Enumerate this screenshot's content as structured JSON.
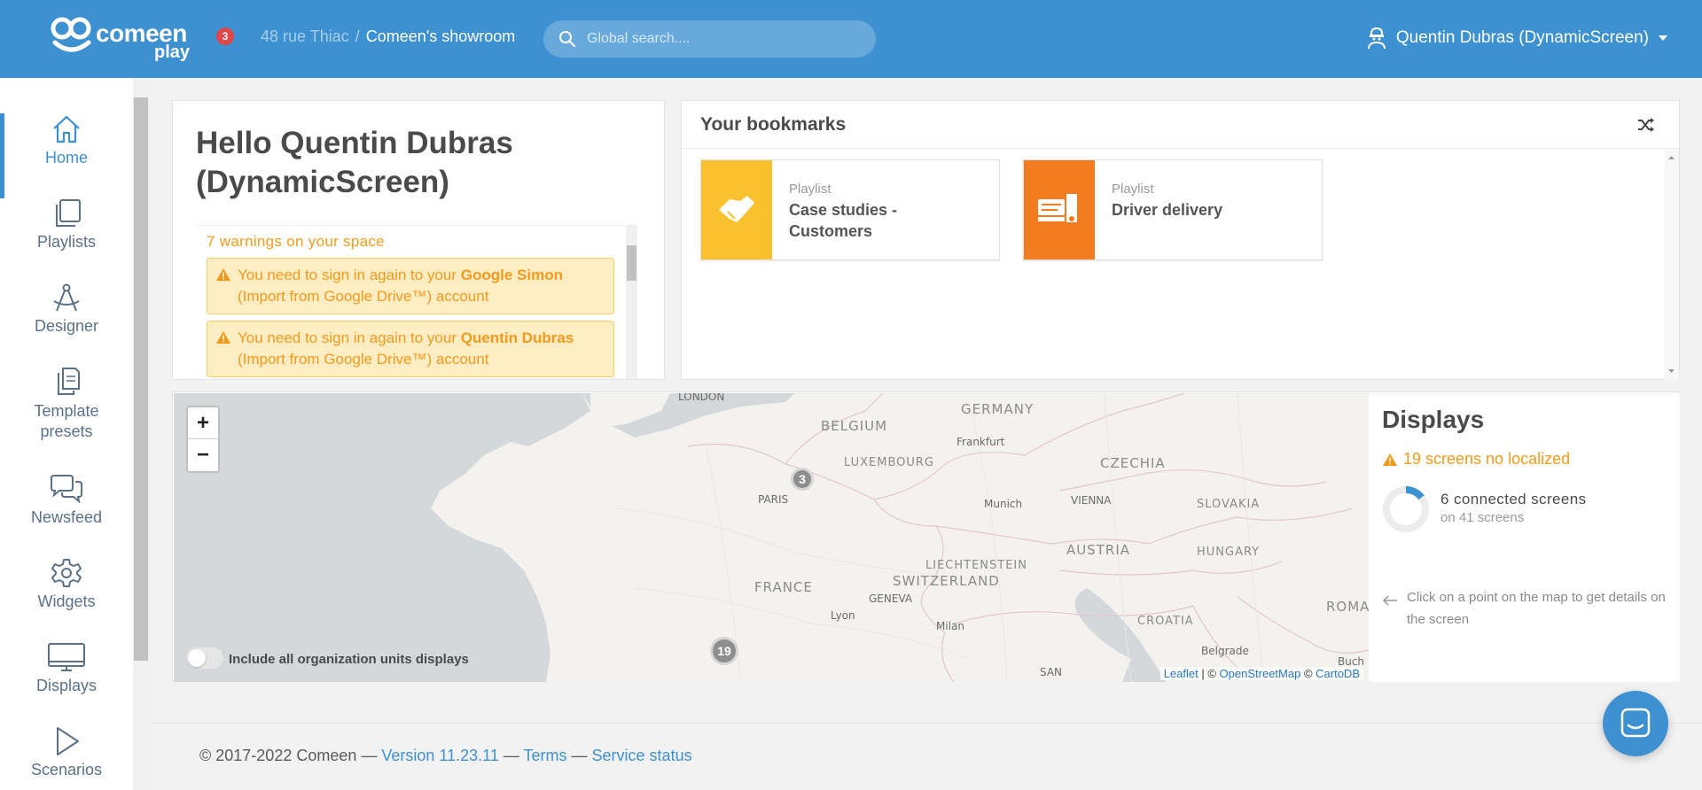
{
  "header": {
    "brand": "comeen",
    "brand_sub": "play",
    "notification_count": "3",
    "breadcrumb": {
      "address": "48 rue Thiac",
      "separator": "/",
      "current": "Comeen's showroom"
    },
    "search_placeholder": "Global search....",
    "user_name": "Quentin Dubras (DynamicScreen)"
  },
  "sidebar": {
    "items": [
      {
        "label": "Home",
        "icon": "home-icon",
        "active": true
      },
      {
        "label": "Playlists",
        "icon": "playlists-icon"
      },
      {
        "label": "Designer",
        "icon": "designer-icon"
      },
      {
        "label": "Template presets",
        "icon": "template-presets-icon"
      },
      {
        "label": "Newsfeed",
        "icon": "newsfeed-icon"
      },
      {
        "label": "Widgets",
        "icon": "widgets-icon"
      },
      {
        "label": "Displays",
        "icon": "displays-icon"
      },
      {
        "label": "Scenarios",
        "icon": "scenarios-icon"
      }
    ]
  },
  "hello": {
    "title": "Hello Quentin Dubras (DynamicScreen)",
    "warnings_title": "7 warnings on your space",
    "warnings": [
      {
        "prefix": "You need to sign in again to your ",
        "account": "Google Simon",
        "suffix": " (Import from Google Drive™) account"
      },
      {
        "prefix": "You need to sign in again to your ",
        "account": "Quentin Dubras",
        "suffix": " (Import from Google Drive™) account"
      }
    ]
  },
  "bookmarks": {
    "title": "Your bookmarks",
    "items": [
      {
        "type": "Playlist",
        "name": "Case studies - Customers",
        "color": "#f9c12e",
        "icon": "handshake-icon"
      },
      {
        "type": "Playlist",
        "name": "Driver delivery",
        "color": "#f47c20",
        "icon": "delivery-truck-icon"
      }
    ]
  },
  "map": {
    "zoom_in": "+",
    "zoom_out": "−",
    "countries": [
      "GERMANY",
      "BELGIUM",
      "LUXEMBOURG",
      "CZECHIA",
      "SLOVAKIA",
      "AUSTRIA",
      "HUNGARY",
      "FRANCE",
      "SWITZERLAND",
      "LIECHTENSTEIN",
      "CROATIA",
      "ROMA"
    ],
    "cities": [
      "LONDON",
      "Frankfurt",
      "PARIS",
      "Munich",
      "VIENNA",
      "GENEVA",
      "Lyon",
      "Milan",
      "Belgrade",
      "SAN",
      "Buch"
    ],
    "clusters": [
      {
        "count": "3"
      },
      {
        "count": "19"
      }
    ],
    "toggle_label": "Include all organization units displays",
    "attribution": {
      "leaflet": "Leaflet",
      "sep": " | © ",
      "osm": "OpenStreetMap",
      "sep2": " © ",
      "carto": "CartoDB"
    }
  },
  "displays": {
    "title": "Displays",
    "not_localized": "19 screens no localized",
    "connected": "6 connected screens",
    "total": "on 41 screens",
    "connected_fraction": 0.146,
    "hint": "Click on a point on the map to get details on the screen"
  },
  "footer": {
    "copyright": "© 2017-2022 Comeen — ",
    "version": "Version 11.23.11",
    "sep1": " — ",
    "terms": "Terms",
    "sep2": " — ",
    "status": "Service status"
  },
  "colors": {
    "primary": "#3d91d1",
    "warning": "#f29b1b",
    "warning_bg": "#feecc3",
    "badge": "#e0454a"
  }
}
